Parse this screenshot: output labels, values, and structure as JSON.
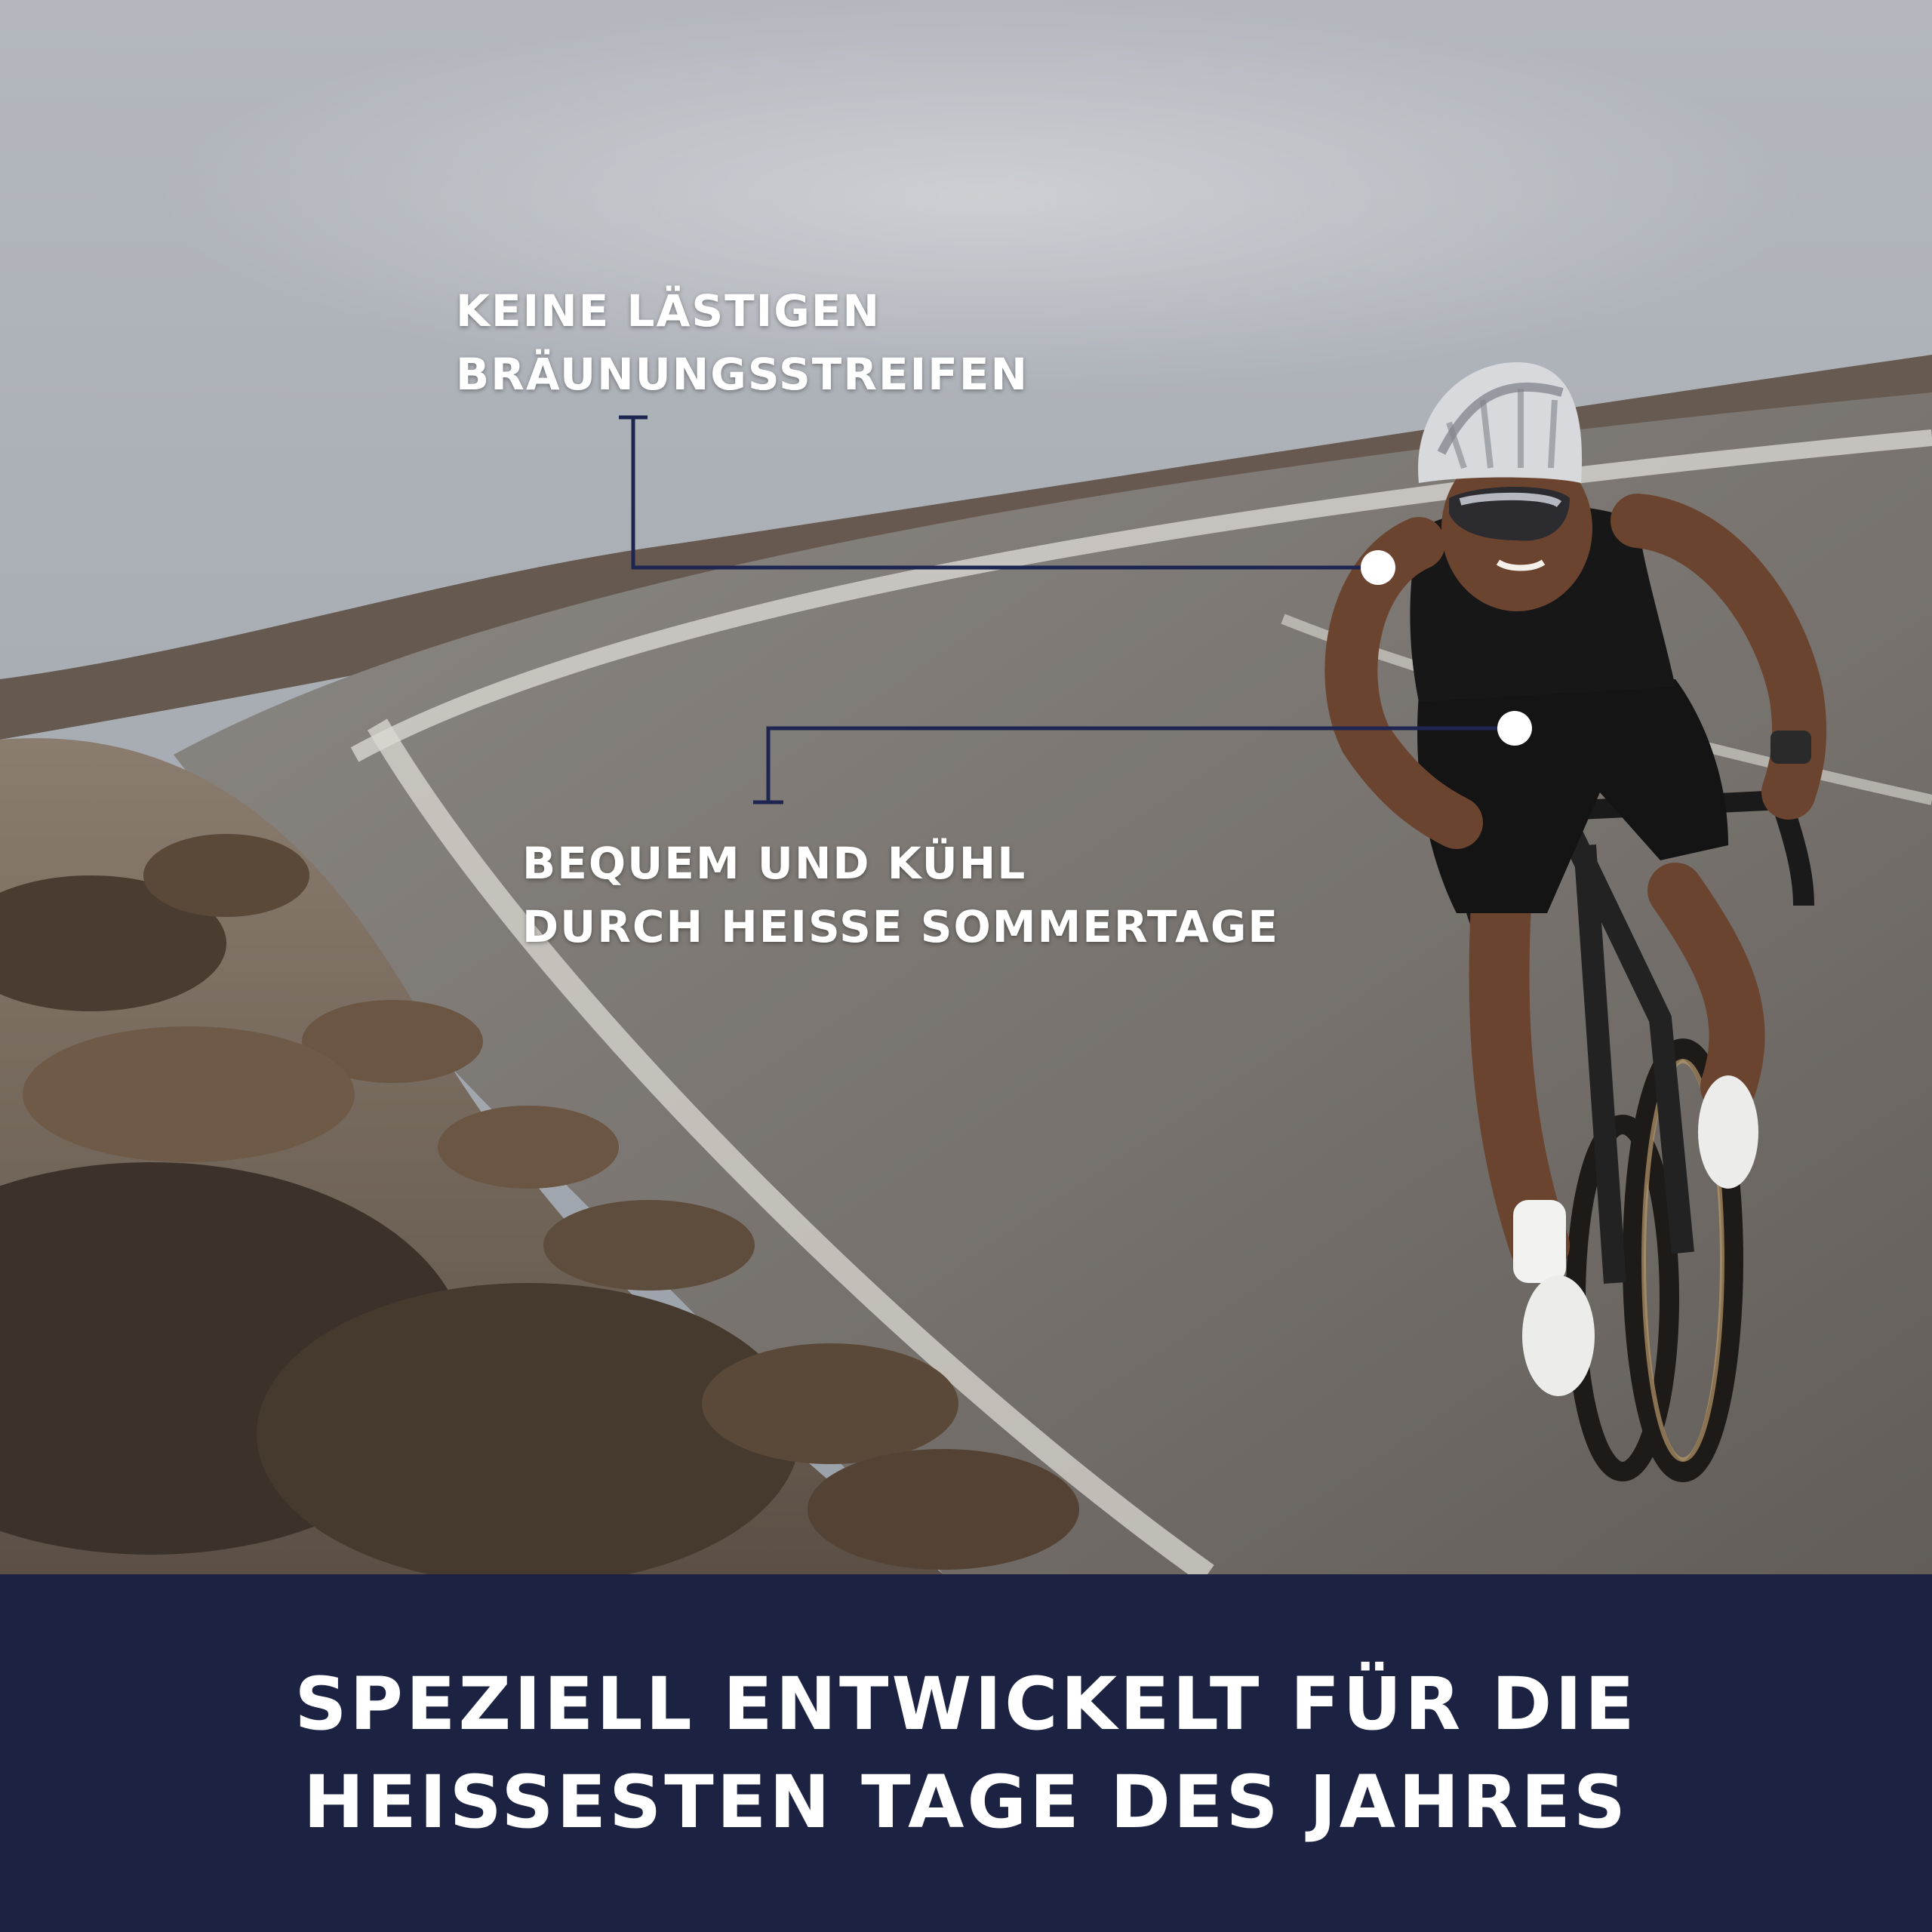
{
  "callouts": [
    {
      "lines": [
        "KEINE LÄSTIGEN",
        "BRÄUNUNGSSTREIFEN"
      ]
    },
    {
      "lines": [
        "BEQUEM UND KÜHL",
        "DURCH HEISSE SOMMERTAGE"
      ]
    }
  ],
  "banner": {
    "lines": [
      "SPEZIELL ENTWICKELT FÜR DIE",
      "HEISSESTEN TAGE DES JAHRES"
    ]
  },
  "colors": {
    "banner_bg": "#1c2242",
    "leader_line": "#1e2550",
    "text": "#ffffff"
  },
  "icons": {
    "callout_marker": "white-dot-icon"
  }
}
